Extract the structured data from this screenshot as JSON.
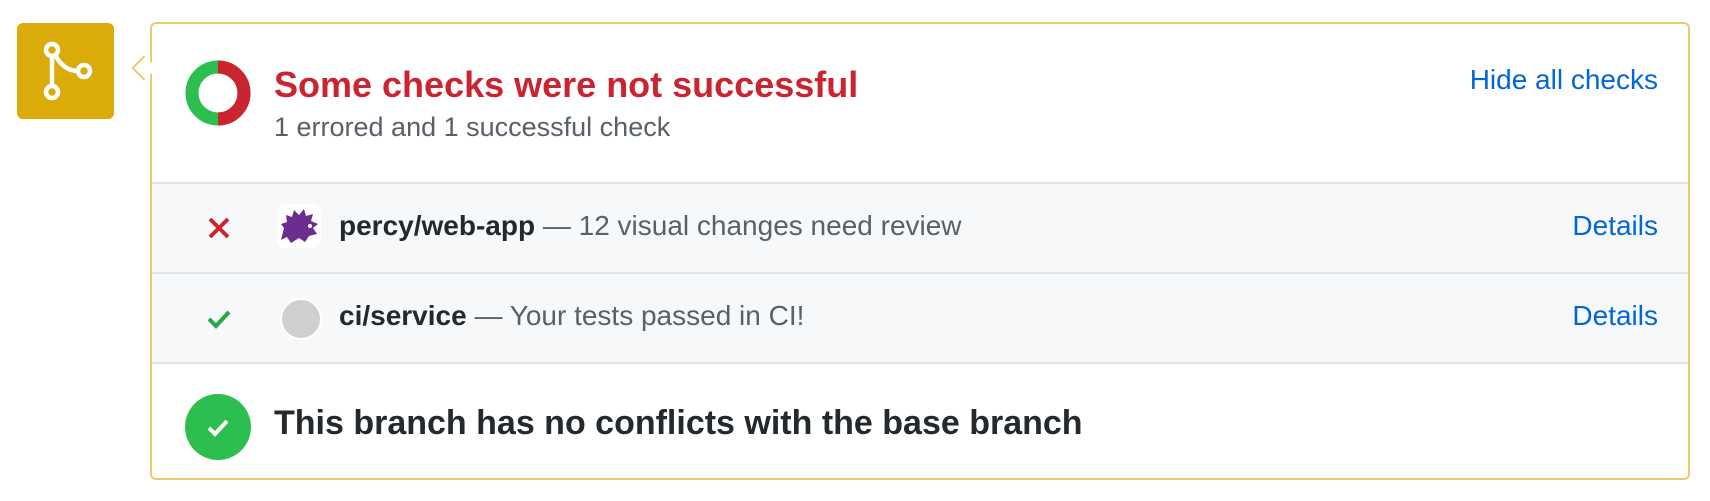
{
  "merge_icon": {
    "icon": "git-merge-icon",
    "color": "#dbab09"
  },
  "status": {
    "icon": "status-donut-icon",
    "title": "Some checks were not successful",
    "subtitle": "1 errored and 1 successful check",
    "toggle_label": "Hide all checks",
    "colors": {
      "error": "#cb2431",
      "success": "#2cbe4e"
    }
  },
  "checks": [
    {
      "state": "error",
      "state_icon": "x-icon",
      "avatar_icon": "percy-hedgehog-icon",
      "context": "percy/web-app",
      "description": " — 12 visual changes need review",
      "details_label": "Details"
    },
    {
      "state": "success",
      "state_icon": "check-icon",
      "avatar_icon": "gray-avatar-icon",
      "context": "ci/service",
      "description": " — Your tests passed in CI!",
      "details_label": "Details"
    }
  ],
  "merge_status": {
    "icon": "check-circle-icon",
    "title": "This branch has no conflicts with the base branch"
  }
}
